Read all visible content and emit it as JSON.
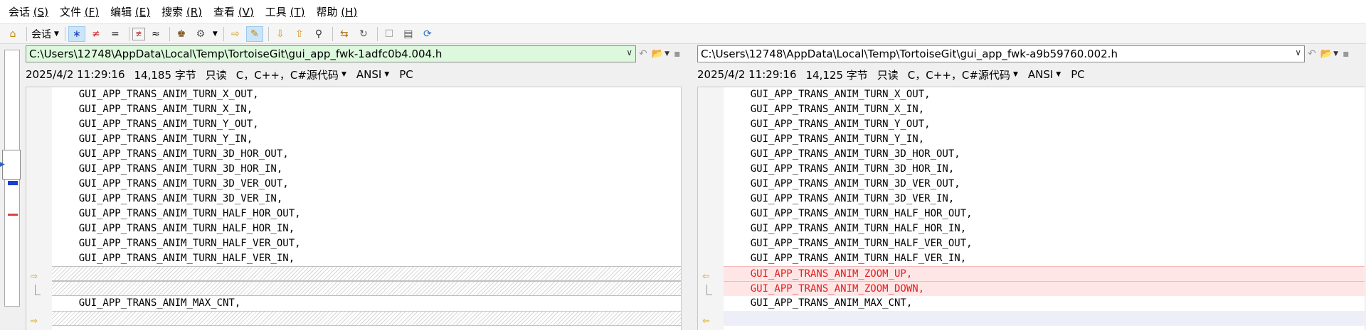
{
  "menu": [
    {
      "label": "会话 ",
      "key": "(S)"
    },
    {
      "label": "文件 ",
      "key": "(F)"
    },
    {
      "label": "编辑 ",
      "key": "(E)"
    },
    {
      "label": "搜索 ",
      "key": "(R)"
    },
    {
      "label": "查看 ",
      "key": "(V)"
    },
    {
      "label": "工具 ",
      "key": "(T)"
    },
    {
      "label": "帮助 ",
      "key": "(H)"
    }
  ],
  "toolbar": {
    "session_label": "会话",
    "icons": [
      "home-icon",
      "session-dropdown",
      "all-diff-icon",
      "not-equal-icon",
      "equal-icon",
      "diff-context-icon",
      "approx-icon",
      "user-icon",
      "rules-icon",
      "next-icon",
      "edit-pencil-icon",
      "next-diff-icon",
      "prev-diff-icon",
      "find-icon",
      "swap-icon",
      "refresh-icon",
      "box-icon",
      "columns-icon",
      "sync-icon"
    ]
  },
  "left": {
    "path": "C:\\Users\\12748\\AppData\\Local\\Temp\\TortoiseGit\\gui_app_fwk-1adfc0b4.004.h",
    "info": {
      "date": "2025/4/2 11:29:16",
      "size": "14,185 字节",
      "readonly": "只读",
      "format": "C，C++，C#源代码",
      "encoding": "ANSI",
      "eol": "PC"
    },
    "lines": [
      {
        "text": "    GUI_APP_TRANS_ANIM_TURN_X_OUT,",
        "type": "normal"
      },
      {
        "text": "    GUI_APP_TRANS_ANIM_TURN_X_IN,",
        "type": "normal"
      },
      {
        "text": "    GUI_APP_TRANS_ANIM_TURN_Y_OUT,",
        "type": "normal"
      },
      {
        "text": "    GUI_APP_TRANS_ANIM_TURN_Y_IN,",
        "type": "normal"
      },
      {
        "text": "    GUI_APP_TRANS_ANIM_TURN_3D_HOR_OUT,",
        "type": "normal"
      },
      {
        "text": "    GUI_APP_TRANS_ANIM_TURN_3D_HOR_IN,",
        "type": "normal"
      },
      {
        "text": "    GUI_APP_TRANS_ANIM_TURN_3D_VER_OUT,",
        "type": "normal"
      },
      {
        "text": "    GUI_APP_TRANS_ANIM_TURN_3D_VER_IN,",
        "type": "normal"
      },
      {
        "text": "    GUI_APP_TRANS_ANIM_TURN_HALF_HOR_OUT,",
        "type": "normal"
      },
      {
        "text": "    GUI_APP_TRANS_ANIM_TURN_HALF_HOR_IN,",
        "type": "normal"
      },
      {
        "text": "    GUI_APP_TRANS_ANIM_TURN_HALF_VER_OUT,",
        "type": "normal"
      },
      {
        "text": "    GUI_APP_TRANS_ANIM_TURN_HALF_VER_IN,",
        "type": "normal"
      },
      {
        "text": "",
        "type": "empty"
      },
      {
        "text": "",
        "type": "empty"
      },
      {
        "text": "    GUI_APP_TRANS_ANIM_MAX_CNT,",
        "type": "normal"
      },
      {
        "text": "",
        "type": "empty"
      }
    ]
  },
  "right": {
    "path": "C:\\Users\\12748\\AppData\\Local\\Temp\\TortoiseGit\\gui_app_fwk-a9b59760.002.h",
    "info": {
      "date": "2025/4/2 11:29:16",
      "size": "14,125 字节",
      "readonly": "只读",
      "format": "C，C++，C#源代码",
      "encoding": "ANSI",
      "eol": "PC"
    },
    "lines": [
      {
        "text": "    GUI_APP_TRANS_ANIM_TURN_X_OUT,",
        "type": "normal"
      },
      {
        "text": "    GUI_APP_TRANS_ANIM_TURN_X_IN,",
        "type": "normal"
      },
      {
        "text": "    GUI_APP_TRANS_ANIM_TURN_Y_OUT,",
        "type": "normal"
      },
      {
        "text": "    GUI_APP_TRANS_ANIM_TURN_Y_IN,",
        "type": "normal"
      },
      {
        "text": "    GUI_APP_TRANS_ANIM_TURN_3D_HOR_OUT,",
        "type": "normal"
      },
      {
        "text": "    GUI_APP_TRANS_ANIM_TURN_3D_HOR_IN,",
        "type": "normal"
      },
      {
        "text": "    GUI_APP_TRANS_ANIM_TURN_3D_VER_OUT,",
        "type": "normal"
      },
      {
        "text": "    GUI_APP_TRANS_ANIM_TURN_3D_VER_IN,",
        "type": "normal"
      },
      {
        "text": "    GUI_APP_TRANS_ANIM_TURN_HALF_HOR_OUT,",
        "type": "normal"
      },
      {
        "text": "    GUI_APP_TRANS_ANIM_TURN_HALF_HOR_IN,",
        "type": "normal"
      },
      {
        "text": "    GUI_APP_TRANS_ANIM_TURN_HALF_VER_OUT,",
        "type": "normal"
      },
      {
        "text": "    GUI_APP_TRANS_ANIM_TURN_HALF_VER_IN,",
        "type": "normal"
      },
      {
        "text": "    GUI_APP_TRANS_ANIM_ZOOM_UP,",
        "type": "added"
      },
      {
        "text": "    GUI_APP_TRANS_ANIM_ZOOM_DOWN,",
        "type": "added"
      },
      {
        "text": "    GUI_APP_TRANS_ANIM_MAX_CNT,",
        "type": "normal"
      },
      {
        "text": "",
        "type": "light"
      }
    ]
  },
  "colors": {
    "added_bg": "#ffe6e6",
    "added_text": "#e02020",
    "left_path_bg": "#ddf9dd",
    "right_path_bg": "#ffffff",
    "marker": "#d4a000"
  }
}
